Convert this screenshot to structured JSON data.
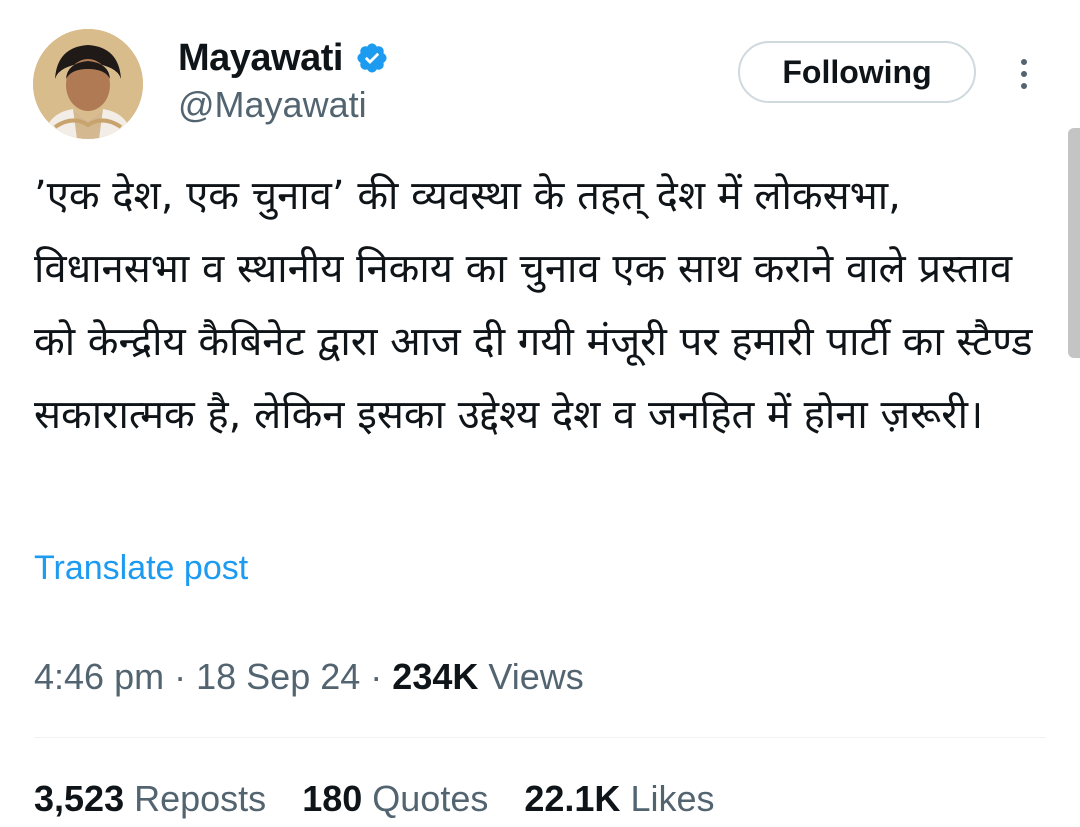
{
  "author": {
    "display_name": "Mayawati",
    "handle": "@Mayawati",
    "verified": true,
    "avatar_icon": "profile-photo"
  },
  "follow_button": {
    "label": "Following"
  },
  "more_button": {
    "icon": "more-vertical-icon"
  },
  "tweet": {
    "text": "’एक देश, एक चुनाव’ की व्यवस्था के तहत् देश में लोकसभा, विधानसभा व स्थानीय निकाय का चुनाव एक साथ कराने वाले प्रस्ताव को केन्द्रीय कैबिनेट द्वारा आज दी गयी मंजूरी पर हमारी पार्टी का स्टैण्ड सकारात्मक है, लेकिन इसका उद्देश्य देश व जनहित में होना ज़रूरी।",
    "translate_label": "Translate post"
  },
  "meta": {
    "time": "4:46 pm",
    "separator": "·",
    "date": "18 Sep 24",
    "views_count": "234K",
    "views_label": "Views"
  },
  "stats": {
    "reposts_count": "3,523",
    "reposts_label": "Reposts",
    "quotes_count": "180",
    "quotes_label": "Quotes",
    "likes_count": "22.1K",
    "likes_label": "Likes"
  },
  "colors": {
    "link": "#1d9bf0",
    "verified": "#1d9bf0",
    "secondary_text": "#536471",
    "primary_text": "#0f1419",
    "button_border": "#cfd9de"
  }
}
